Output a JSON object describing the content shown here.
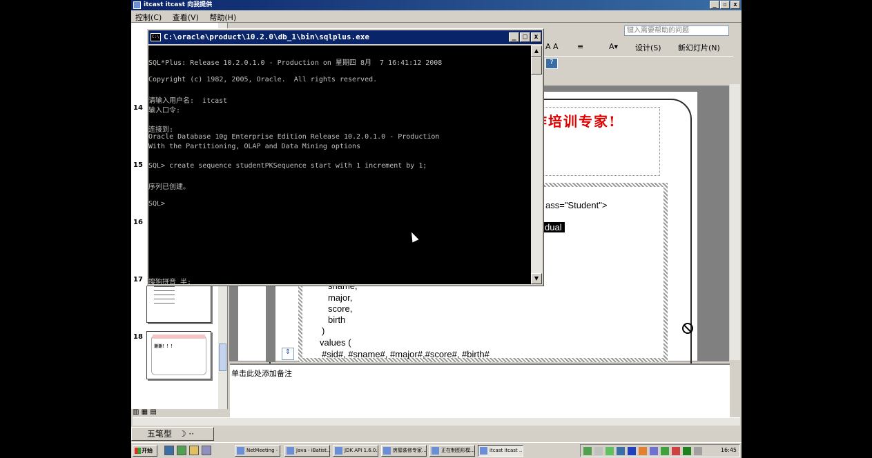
{
  "app": {
    "title": "itcast itcast 向我提供",
    "menu": [
      "控制(C)",
      "查看(V)",
      "帮助(H)"
    ],
    "help_placeholder": "键入需要帮助的问题",
    "toolbar_design": "设计(S)",
    "toolbar_new_slide": "新幻灯片(N)"
  },
  "slides_pane": {
    "numbers": [
      "14",
      "15",
      "16",
      "17",
      "18"
    ],
    "thumb18_text": "谢谢！！！"
  },
  "slide": {
    "title_fragment": "作培训专家!",
    "code_lines": {
      "class_attr": "ass=\"Student\">",
      "dual": "dual",
      "sname": "sname,",
      "major": "major,",
      "score": "score,",
      "birth": "birth",
      "paren": ")",
      "values": "values (",
      "params": "#sid#, #sname#, #major#,#score#, #birth#"
    }
  },
  "notes": {
    "placeholder": "单击此处添加备注"
  },
  "ime": {
    "label": "五笔型"
  },
  "sqlplus": {
    "title": "C:\\oracle\\product\\10.2.0\\db_1\\bin\\sqlplus.exe",
    "lines": [
      "SQL*Plus: Release 10.2.0.1.0 - Production on 星期四 8月  7 16:41:12 2008",
      "",
      "Copyright (c) 1982, 2005, Oracle.  All rights reserved.",
      "",
      "请输入用户名:  itcast",
      "输入口令:",
      "",
      "连接到:",
      "Oracle Database 10g Enterprise Edition Release 10.2.0.1.0 - Production",
      "With the Partitioning, OLAP and Data Mining options",
      "",
      "SQL> create sequence studentPKSequence start with 1 increment by 1;",
      "",
      "序列已创建。",
      "",
      "SQL>"
    ],
    "ime_line": "搜狗拼音 半:"
  },
  "taskbar": {
    "start": "开始",
    "tasks": [
      "NetMeeting - ...",
      "Java - iBatist...",
      "JDK API 1.6.0...",
      "房屋装修专家...",
      "正在制图形模...",
      "itcast itcast ..."
    ],
    "clock": "16:45"
  }
}
